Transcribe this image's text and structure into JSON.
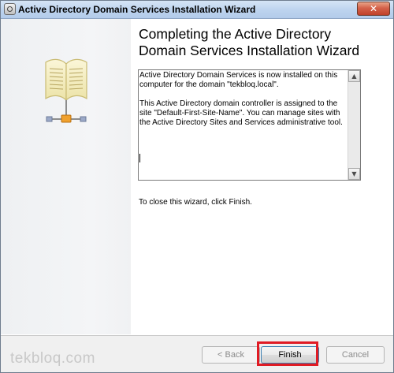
{
  "window": {
    "title": "Active Directory Domain Services Installation Wizard",
    "close_glyph": "✕"
  },
  "heading": "Completing the Active Directory Domain Services Installation Wizard",
  "summary": {
    "paragraph1": "Active Directory Domain Services is now installed on this computer for the domain \"tekbloq.local\".",
    "paragraph2": "This Active Directory domain controller is assigned to the site \"Default-First-Site-Name\". You can manage sites with the Active Directory Sites and Services administrative tool."
  },
  "close_hint": "To close this wizard, click Finish.",
  "buttons": {
    "back": "< Back",
    "finish": "Finish",
    "cancel": "Cancel"
  },
  "watermark": "tekbloq.com",
  "icons": {
    "app": "wizard-app-icon",
    "book": "book-network-icon",
    "scroll_up": "▲",
    "scroll_down": "▼"
  },
  "colors": {
    "highlight": "#e01b24",
    "titlebar": "#bdd3ee",
    "close": "#c0402a"
  }
}
